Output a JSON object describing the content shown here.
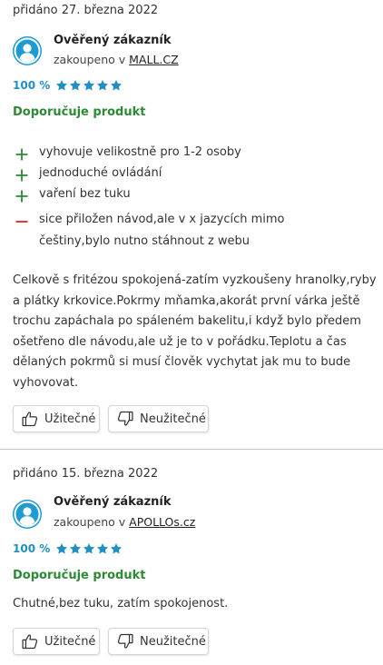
{
  "colors": {
    "accent_blue": "#1f9bd1",
    "star_blue": "#1f8fc4",
    "positive_green": "#2c8a35",
    "negative_red": "#e0262a"
  },
  "reviews": [
    {
      "date": "přidáno 27. března 2022",
      "author": "Ověřený zákazník",
      "bought_prefix": "zakoupeno v",
      "shop": "MALL.CZ",
      "score": "100 %",
      "stars": 5,
      "recommend": "Doporučuje produkt",
      "pros": [
        "vyhovuje velikostně pro 1-2 osoby",
        "jednoduché ovládání",
        "vaření bez tuku"
      ],
      "cons": [
        "sice přiložen návod,ale v x jazycích mimo češtiny,bylo nutno stáhnout z webu"
      ],
      "text": "Celkově s fritézou spokojená-zatím vyzkoušeny hranolky,ryby a plátky krkovice.Pokrmy mňamka,akorát první várka ještě trochu zapáchala po spáleném bakelitu,i když bylo předem ošetřeno dle návodu,ale už je to v pořádku.Teplotu a čas dělaných pokrmů si musí člověk vychytat jak mu to bude vyhovovat.",
      "useful_label": "Užitečné",
      "useless_label": "Neužitečné"
    },
    {
      "date": "přidáno 15. března 2022",
      "author": "Ověřený zákazník",
      "bought_prefix": "zakoupeno v",
      "shop": "APOLLOs.cz",
      "score": "100 %",
      "stars": 5,
      "recommend": "Doporučuje produkt",
      "pros": [],
      "cons": [],
      "text": "Chutné,bez tuku, zatím spokojenost.",
      "useful_label": "Užitečné",
      "useless_label": "Neužitečné"
    }
  ]
}
